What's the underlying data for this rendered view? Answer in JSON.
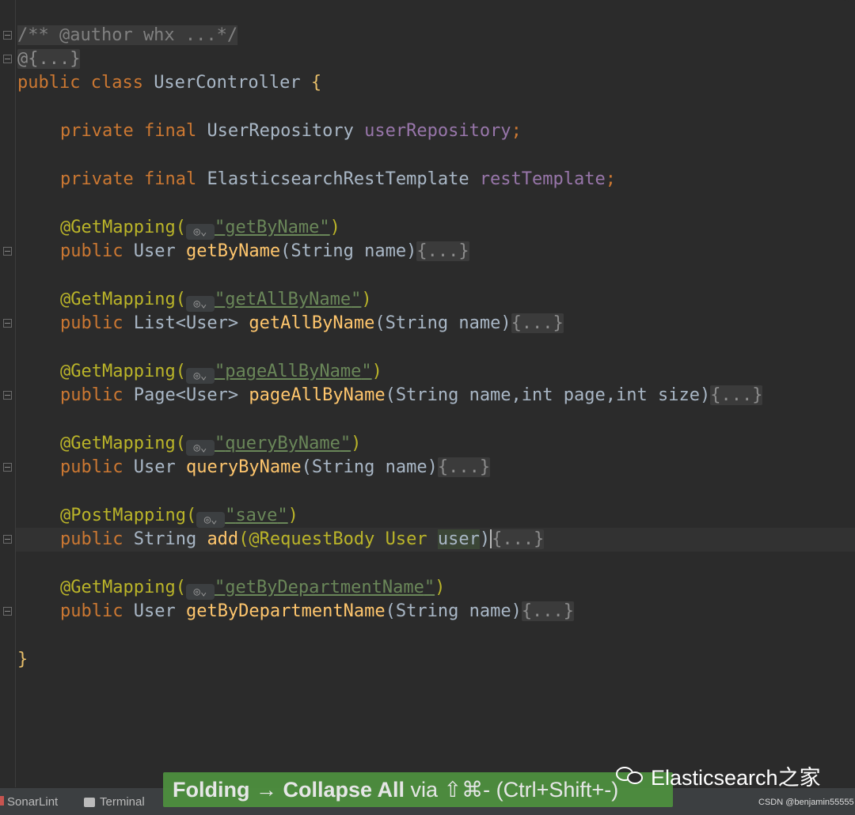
{
  "code": {
    "line1_comment": "/** @author whx ...*/",
    "line2_annot": "@{...}",
    "line3": {
      "kw": "public class ",
      "name": "UserController ",
      "brace": "{"
    },
    "field1": {
      "kw": "private final ",
      "type": "UserRepository ",
      "name": "userRepository",
      "semi": ";"
    },
    "field2": {
      "kw": "private final ",
      "type": "ElasticsearchRestTemplate ",
      "name": "restTemplate",
      "semi": ";"
    },
    "methods": [
      {
        "annotation": "@GetMapping(",
        "path": "getByName",
        "signature_kw": "public ",
        "ret": "User ",
        "name": "getByName",
        "params": "(String name)",
        "body": "{...}"
      },
      {
        "annotation": "@GetMapping(",
        "path": "getAllByName",
        "signature_kw": "public ",
        "ret": "List<User> ",
        "name": "getAllByName",
        "params": "(String name)",
        "body": "{...}"
      },
      {
        "annotation": "@GetMapping(",
        "path": "pageAllByName",
        "signature_kw": "public ",
        "ret": "Page<User> ",
        "name": "pageAllByName",
        "params": "(String name,int page,int size)",
        "body": "{...}"
      },
      {
        "annotation": "@GetMapping(",
        "path": "queryByName",
        "signature_kw": "public ",
        "ret": "User ",
        "name": "queryByName",
        "params": "(String name)",
        "body": "{...}"
      },
      {
        "annotation": "@PostMapping(",
        "path": "save",
        "signature_kw": "public ",
        "ret": "String ",
        "name": "add",
        "params_a": "(@RequestBody User ",
        "params_b": "user",
        "params_c": ")",
        "body": "{...}"
      },
      {
        "annotation": "@GetMapping(",
        "path": "getByDepartmentName",
        "signature_kw": "public ",
        "ret": "User ",
        "name": "getByDepartmentName",
        "params": "(String name)",
        "body": "{...}"
      }
    ],
    "closing": "}",
    "globe_glyph": "◎⌄",
    "quote": "\"",
    "close_paren": ")"
  },
  "statusbar": {
    "sonarlint": "SonarLint",
    "terminal": "Terminal"
  },
  "tooltip": {
    "action": "Folding → Collapse All",
    "via": " via ⇧⌘- (Ctrl+Shift+",
    "tail": "-)"
  },
  "watermark": {
    "text": "Elasticsearch之家",
    "csdn": "CSDN @benjamin55555"
  },
  "colors": {
    "keyword": "#cc7832",
    "field": "#9876aa",
    "annotation": "#bbb529",
    "string": "#6a8759",
    "method": "#ffc66d",
    "tooltip_bg": "#4d8f3e"
  }
}
